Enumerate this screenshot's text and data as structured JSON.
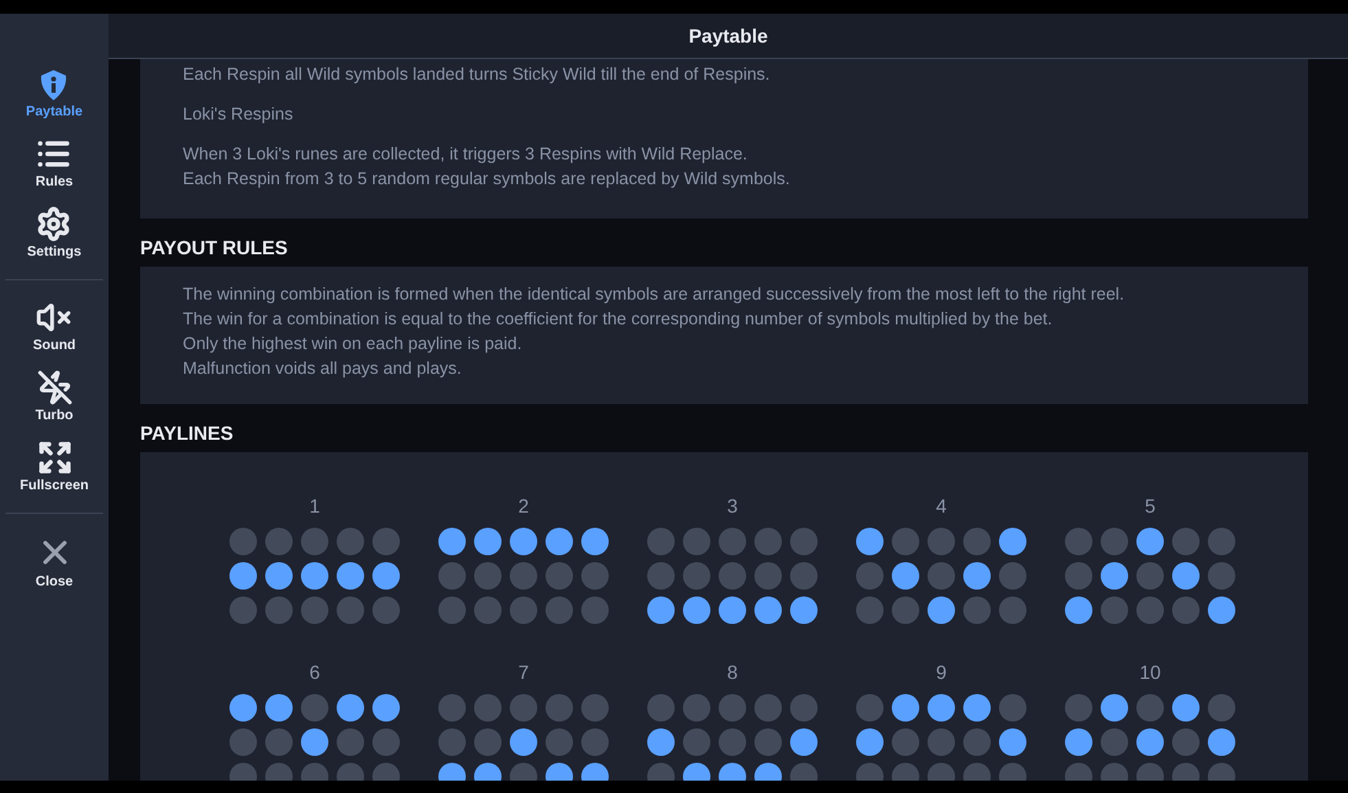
{
  "header": {
    "title": "Paytable"
  },
  "sidebar": {
    "groups": [
      [
        {
          "label": "Paytable",
          "kind": "info",
          "selected": true
        },
        {
          "label": "Rules",
          "kind": "list",
          "selected": false
        },
        {
          "label": "Settings",
          "kind": "gear",
          "selected": false
        }
      ],
      [
        {
          "label": "Sound",
          "kind": "sound",
          "selected": false
        },
        {
          "label": "Turbo",
          "kind": "turbo",
          "selected": false
        },
        {
          "label": "Fullscreen",
          "kind": "fullscreen",
          "selected": false
        }
      ],
      [
        {
          "label": "Close",
          "kind": "close",
          "selected": false
        }
      ]
    ]
  },
  "intro_panel": {
    "paragraphs": [
      [
        "Each Respin all Wild symbols landed turns Sticky Wild till the end of Respins."
      ],
      [
        "Loki's Respins"
      ],
      [
        "When 3 Loki's runes are collected, it triggers 3 Respins with Wild Replace.",
        "Each Respin from 3 to 5 random regular symbols are replaced by Wild symbols."
      ]
    ]
  },
  "payout_rules": {
    "title": "PAYOUT RULES",
    "lines": [
      "The winning combination is formed when the identical symbols are arranged successively from the most left to the right reel.",
      "The win for a combination is equal to the coefficient for the corresponding number of symbols multiplied by the bet.",
      "Only the highest win on each payline is paid.",
      "Malfunction voids all pays and plays."
    ]
  },
  "paylines": {
    "title": "PAYLINES",
    "lines": [
      {
        "number": "1",
        "rows": [
          [
            false,
            false,
            false,
            false,
            false
          ],
          [
            true,
            true,
            true,
            true,
            true
          ],
          [
            false,
            false,
            false,
            false,
            false
          ]
        ]
      },
      {
        "number": "2",
        "rows": [
          [
            true,
            true,
            true,
            true,
            true
          ],
          [
            false,
            false,
            false,
            false,
            false
          ],
          [
            false,
            false,
            false,
            false,
            false
          ]
        ]
      },
      {
        "number": "3",
        "rows": [
          [
            false,
            false,
            false,
            false,
            false
          ],
          [
            false,
            false,
            false,
            false,
            false
          ],
          [
            true,
            true,
            true,
            true,
            true
          ]
        ]
      },
      {
        "number": "4",
        "rows": [
          [
            true,
            false,
            false,
            false,
            true
          ],
          [
            false,
            true,
            false,
            true,
            false
          ],
          [
            false,
            false,
            true,
            false,
            false
          ]
        ]
      },
      {
        "number": "5",
        "rows": [
          [
            false,
            false,
            true,
            false,
            false
          ],
          [
            false,
            true,
            false,
            true,
            false
          ],
          [
            true,
            false,
            false,
            false,
            true
          ]
        ]
      },
      {
        "number": "6",
        "rows": [
          [
            true,
            true,
            false,
            true,
            true
          ],
          [
            false,
            false,
            true,
            false,
            false
          ],
          [
            false,
            false,
            false,
            false,
            false
          ]
        ]
      },
      {
        "number": "7",
        "rows": [
          [
            false,
            false,
            false,
            false,
            false
          ],
          [
            false,
            false,
            true,
            false,
            false
          ],
          [
            true,
            true,
            false,
            true,
            true
          ]
        ]
      },
      {
        "number": "8",
        "rows": [
          [
            false,
            false,
            false,
            false,
            false
          ],
          [
            true,
            false,
            false,
            false,
            true
          ],
          [
            false,
            true,
            true,
            true,
            false
          ]
        ]
      },
      {
        "number": "9",
        "rows": [
          [
            false,
            true,
            true,
            true,
            false
          ],
          [
            true,
            false,
            false,
            false,
            true
          ],
          [
            false,
            false,
            false,
            false,
            false
          ]
        ]
      },
      {
        "number": "10",
        "rows": [
          [
            false,
            true,
            false,
            true,
            false
          ],
          [
            true,
            false,
            true,
            false,
            true
          ],
          [
            false,
            false,
            false,
            false,
            false
          ]
        ]
      }
    ]
  }
}
